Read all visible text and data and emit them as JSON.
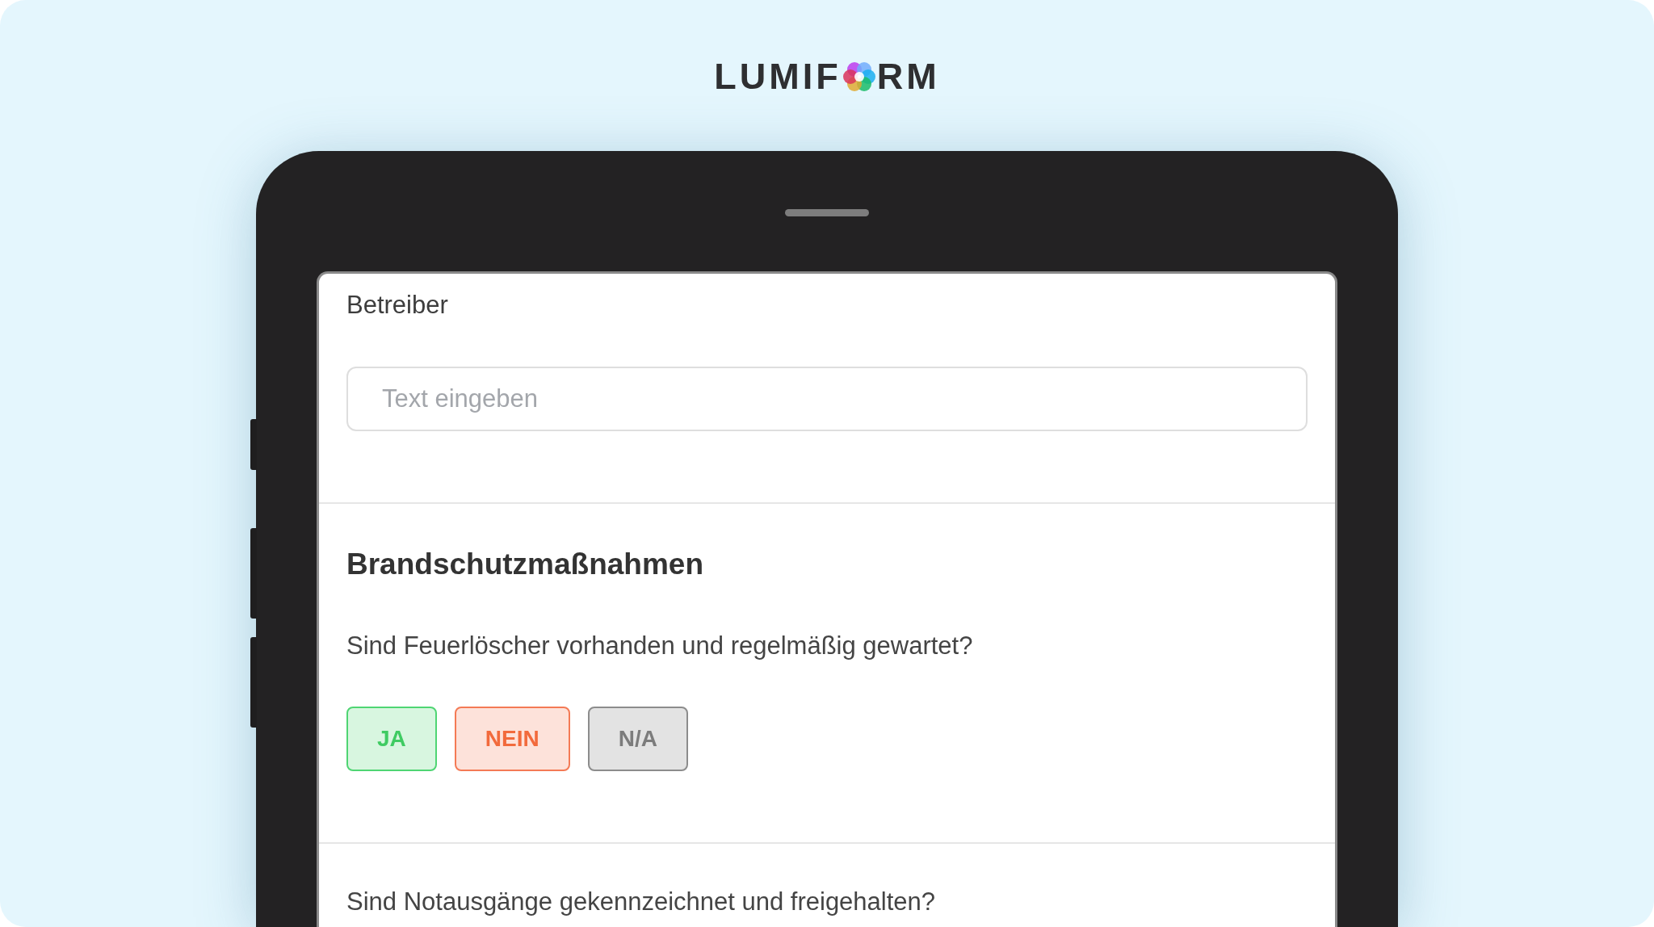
{
  "logo": {
    "text_before": "LUMIF",
    "text_after": "RM"
  },
  "form": {
    "field": {
      "label": "Betreiber",
      "placeholder": "Text eingeben"
    },
    "section": {
      "title": "Brandschutzmaßnahmen",
      "questions": [
        {
          "text": "Sind Feuerlöscher vorhanden und regelmäßig gewartet?",
          "options": [
            {
              "label": "JA",
              "kind": "yes"
            },
            {
              "label": "NEIN",
              "kind": "no"
            },
            {
              "label": "N/A",
              "kind": "na"
            }
          ]
        },
        {
          "text": "Sind Notausgänge gekennzeichnet und freigehalten?"
        }
      ]
    }
  }
}
